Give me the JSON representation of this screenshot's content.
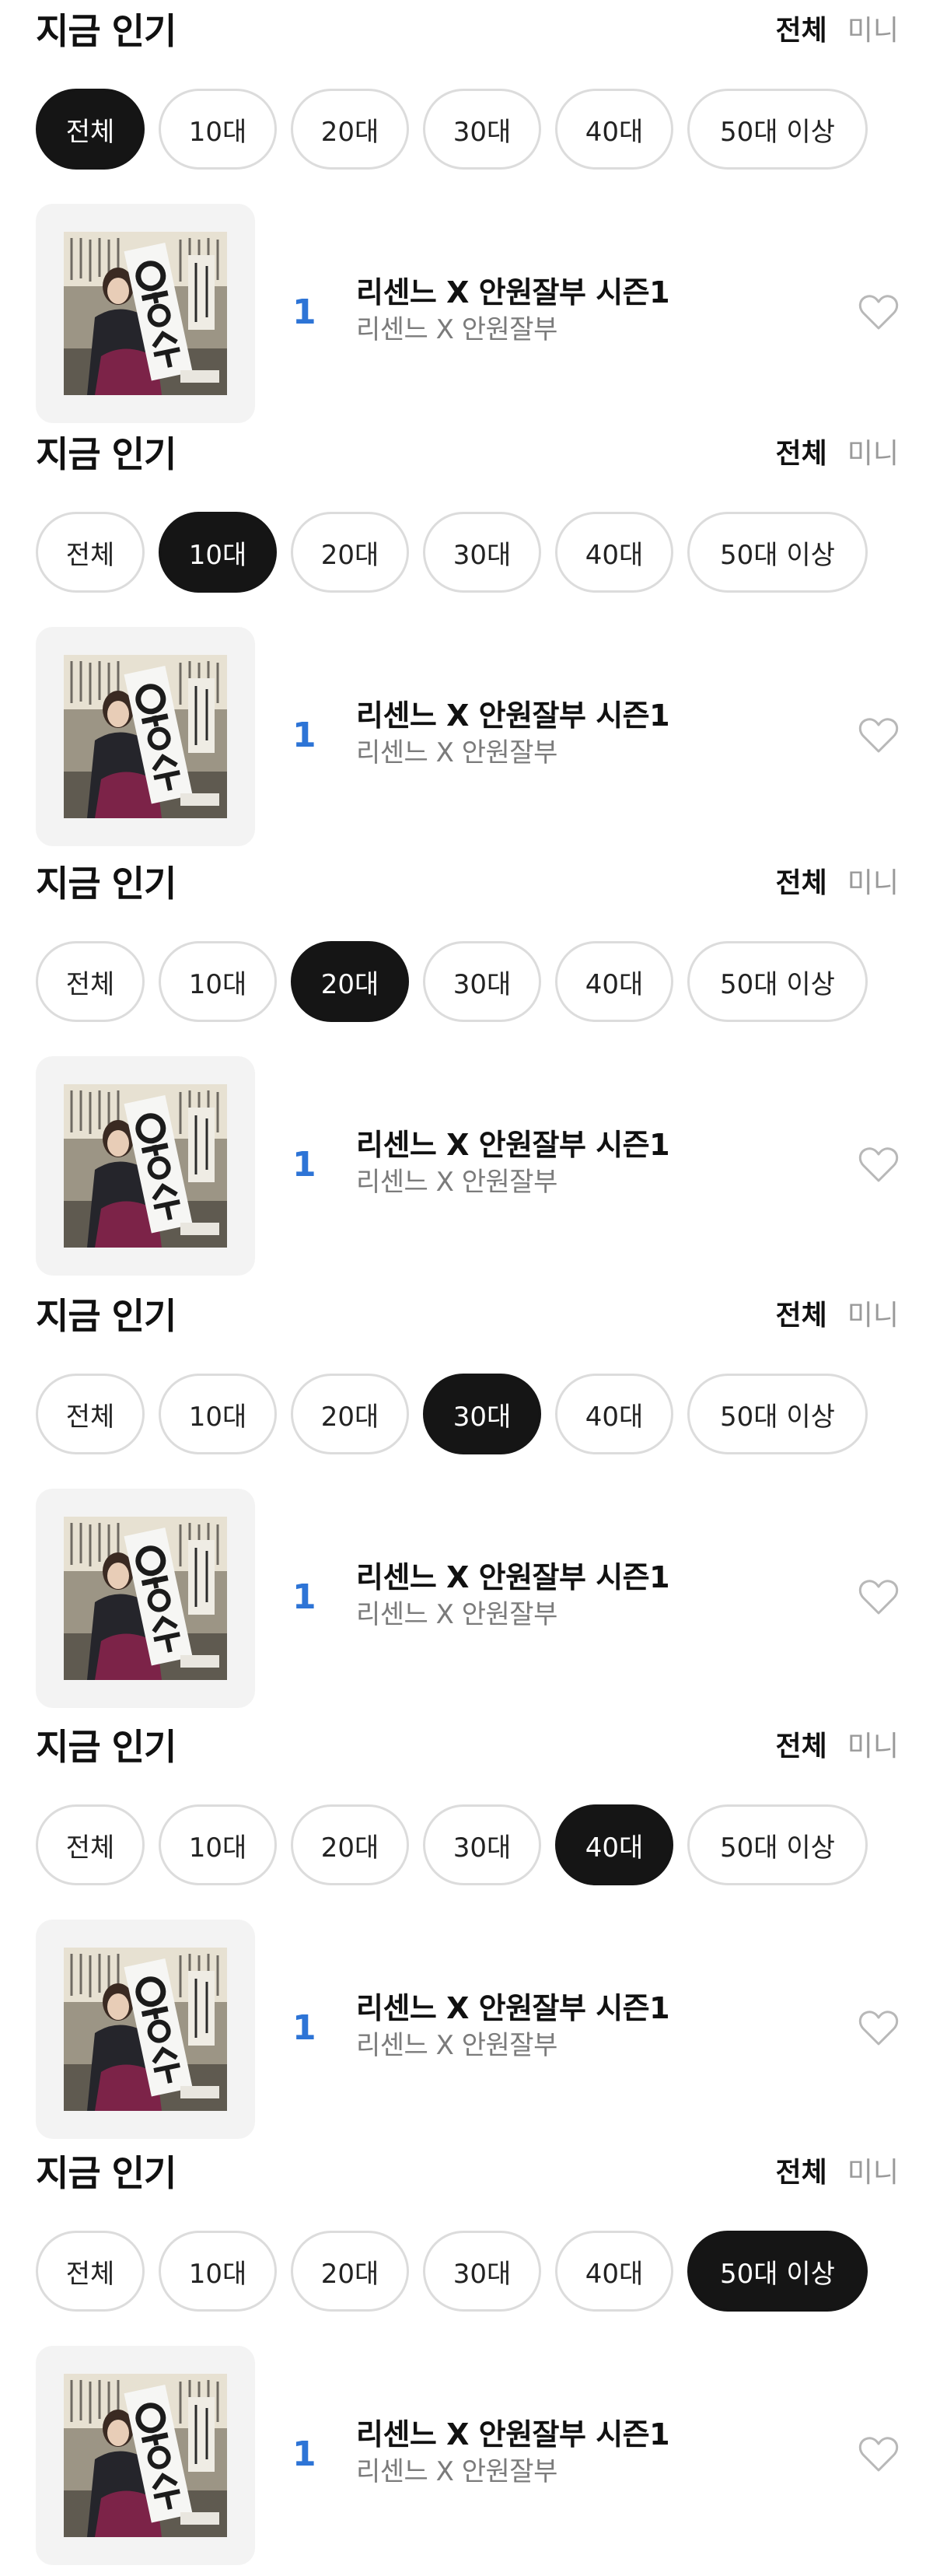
{
  "sections": [
    {
      "title": "지금 인기",
      "toggle_all": "전체",
      "toggle_mini": "미니",
      "active_filter": 0
    },
    {
      "title": "지금 인기",
      "toggle_all": "전체",
      "toggle_mini": "미니",
      "active_filter": 1
    },
    {
      "title": "지금 인기",
      "toggle_all": "전체",
      "toggle_mini": "미니",
      "active_filter": 2
    },
    {
      "title": "지금 인기",
      "toggle_all": "전체",
      "toggle_mini": "미니",
      "active_filter": 3
    },
    {
      "title": "지금 인기",
      "toggle_all": "전체",
      "toggle_mini": "미니",
      "active_filter": 4
    },
    {
      "title": "지금 인기",
      "toggle_all": "전체",
      "toggle_mini": "미니",
      "active_filter": 5
    }
  ],
  "filters": [
    "전체",
    "10대",
    "20대",
    "30대",
    "40대",
    "50대 이상"
  ],
  "item": {
    "rank": "1",
    "title": "리센느 X 안원잘부 시즌1",
    "artist": "리센느 X 안원잘부",
    "thumbnail_icon": "album-cover-image",
    "like_icon": "heart-outline-icon"
  },
  "colors": {
    "rank": "#2d74d6",
    "active_chip": "#151515",
    "inactive_toggle": "#9a9a9a",
    "artist_text": "#7b7b7b"
  }
}
